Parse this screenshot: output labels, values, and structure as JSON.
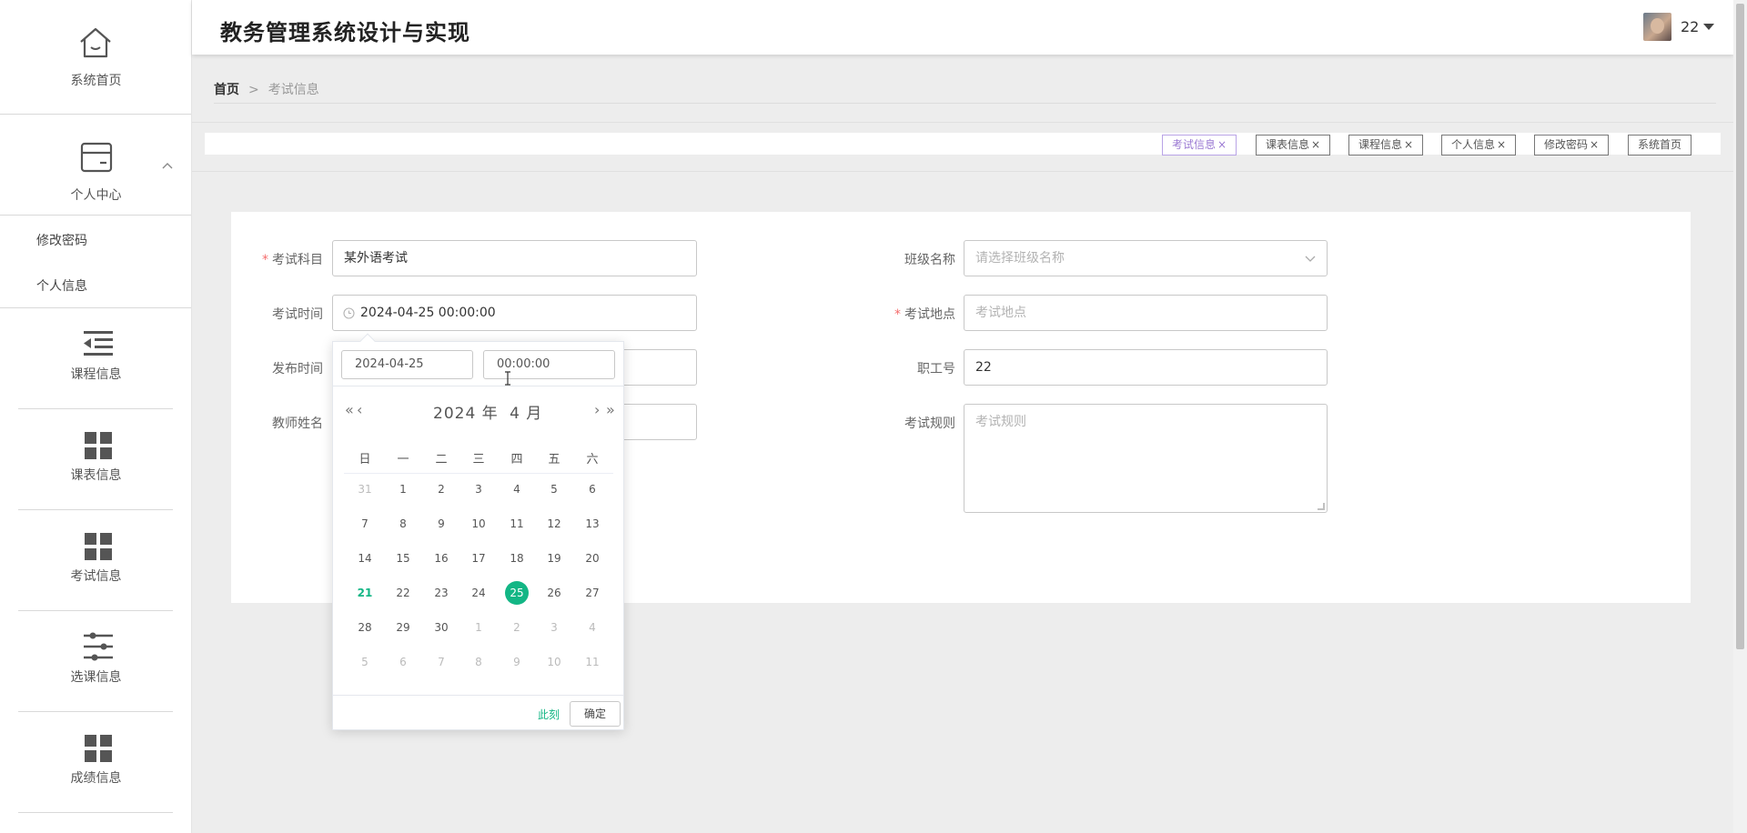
{
  "app": {
    "title": "教务管理系统设计与实现"
  },
  "user": {
    "name": "22"
  },
  "sidebar": {
    "home": {
      "label": "系统首页",
      "icon": "home-icon"
    },
    "personal_center": {
      "label": "个人中心",
      "icon": "card-icon",
      "sub_items": [
        {
          "label": "修改密码"
        },
        {
          "label": "个人信息"
        }
      ]
    },
    "items": [
      {
        "label": "课程信息",
        "icon": "list-icon"
      },
      {
        "label": "课表信息",
        "icon": "grid-icon"
      },
      {
        "label": "考试信息",
        "icon": "grid-icon"
      },
      {
        "label": "选课信息",
        "icon": "sliders-icon"
      },
      {
        "label": "成绩信息",
        "icon": "grid-icon"
      }
    ]
  },
  "breadcrumb": {
    "home": "首页",
    "separator": ">",
    "current": "考试信息"
  },
  "tabs": [
    {
      "label": "考试信息",
      "close": "×",
      "active": true
    },
    {
      "label": "课表信息",
      "close": "×"
    },
    {
      "label": "课程信息",
      "close": "×"
    },
    {
      "label": "个人信息",
      "close": "×"
    },
    {
      "label": "修改密码",
      "close": "×"
    },
    {
      "label": "系统首页",
      "close": ""
    }
  ],
  "form": {
    "subject": {
      "label": "考试科目",
      "required": "*",
      "value": "某外语考试"
    },
    "exam_time": {
      "label": "考试时间",
      "value": "2024-04-25 00:00:00"
    },
    "publish_time": {
      "label": "发布时间"
    },
    "teacher_name": {
      "label": "教师姓名"
    },
    "class_name": {
      "label": "班级名称",
      "placeholder": "请选择班级名称"
    },
    "location": {
      "label": "考试地点",
      "required": "*",
      "placeholder": "考试地点"
    },
    "staff_id": {
      "label": "职工号",
      "value": "22"
    },
    "rules": {
      "label": "考试规则",
      "placeholder": "考试规则"
    }
  },
  "datepicker": {
    "date_input": "2024-04-25",
    "time_input": "00:00:00",
    "year_label": "2024 年",
    "month_label": "4 月",
    "prev_year": "«",
    "prev_month": "‹",
    "next_month": "›",
    "next_year": "»",
    "weekdays": [
      "日",
      "一",
      "二",
      "三",
      "四",
      "五",
      "六"
    ],
    "days": [
      [
        "31",
        "1",
        "2",
        "3",
        "4",
        "5",
        "6"
      ],
      [
        "7",
        "8",
        "9",
        "10",
        "11",
        "12",
        "13"
      ],
      [
        "14",
        "15",
        "16",
        "17",
        "18",
        "19",
        "20"
      ],
      [
        "21",
        "22",
        "23",
        "24",
        "25",
        "26",
        "27"
      ],
      [
        "28",
        "29",
        "30",
        "1",
        "2",
        "3",
        "4"
      ],
      [
        "5",
        "6",
        "7",
        "8",
        "9",
        "10",
        "11"
      ]
    ],
    "today": "21",
    "selected": "25",
    "now_label": "此刻",
    "ok_label": "确定"
  },
  "colors": {
    "accent": "#13b685",
    "active_tab": "#9b7ad3",
    "required": "#f56c6c"
  }
}
